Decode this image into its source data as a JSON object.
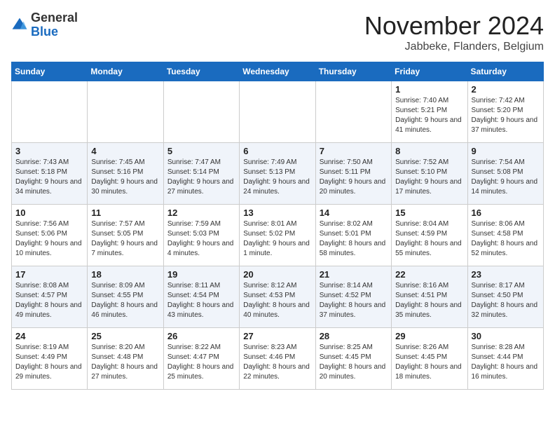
{
  "logo": {
    "general": "General",
    "blue": "Blue"
  },
  "title": "November 2024",
  "location": "Jabbeke, Flanders, Belgium",
  "days_of_week": [
    "Sunday",
    "Monday",
    "Tuesday",
    "Wednesday",
    "Thursday",
    "Friday",
    "Saturday"
  ],
  "weeks": [
    [
      {
        "day": "",
        "info": ""
      },
      {
        "day": "",
        "info": ""
      },
      {
        "day": "",
        "info": ""
      },
      {
        "day": "",
        "info": ""
      },
      {
        "day": "",
        "info": ""
      },
      {
        "day": "1",
        "info": "Sunrise: 7:40 AM\nSunset: 5:21 PM\nDaylight: 9 hours and 41 minutes."
      },
      {
        "day": "2",
        "info": "Sunrise: 7:42 AM\nSunset: 5:20 PM\nDaylight: 9 hours and 37 minutes."
      }
    ],
    [
      {
        "day": "3",
        "info": "Sunrise: 7:43 AM\nSunset: 5:18 PM\nDaylight: 9 hours and 34 minutes."
      },
      {
        "day": "4",
        "info": "Sunrise: 7:45 AM\nSunset: 5:16 PM\nDaylight: 9 hours and 30 minutes."
      },
      {
        "day": "5",
        "info": "Sunrise: 7:47 AM\nSunset: 5:14 PM\nDaylight: 9 hours and 27 minutes."
      },
      {
        "day": "6",
        "info": "Sunrise: 7:49 AM\nSunset: 5:13 PM\nDaylight: 9 hours and 24 minutes."
      },
      {
        "day": "7",
        "info": "Sunrise: 7:50 AM\nSunset: 5:11 PM\nDaylight: 9 hours and 20 minutes."
      },
      {
        "day": "8",
        "info": "Sunrise: 7:52 AM\nSunset: 5:10 PM\nDaylight: 9 hours and 17 minutes."
      },
      {
        "day": "9",
        "info": "Sunrise: 7:54 AM\nSunset: 5:08 PM\nDaylight: 9 hours and 14 minutes."
      }
    ],
    [
      {
        "day": "10",
        "info": "Sunrise: 7:56 AM\nSunset: 5:06 PM\nDaylight: 9 hours and 10 minutes."
      },
      {
        "day": "11",
        "info": "Sunrise: 7:57 AM\nSunset: 5:05 PM\nDaylight: 9 hours and 7 minutes."
      },
      {
        "day": "12",
        "info": "Sunrise: 7:59 AM\nSunset: 5:03 PM\nDaylight: 9 hours and 4 minutes."
      },
      {
        "day": "13",
        "info": "Sunrise: 8:01 AM\nSunset: 5:02 PM\nDaylight: 9 hours and 1 minute."
      },
      {
        "day": "14",
        "info": "Sunrise: 8:02 AM\nSunset: 5:01 PM\nDaylight: 8 hours and 58 minutes."
      },
      {
        "day": "15",
        "info": "Sunrise: 8:04 AM\nSunset: 4:59 PM\nDaylight: 8 hours and 55 minutes."
      },
      {
        "day": "16",
        "info": "Sunrise: 8:06 AM\nSunset: 4:58 PM\nDaylight: 8 hours and 52 minutes."
      }
    ],
    [
      {
        "day": "17",
        "info": "Sunrise: 8:08 AM\nSunset: 4:57 PM\nDaylight: 8 hours and 49 minutes."
      },
      {
        "day": "18",
        "info": "Sunrise: 8:09 AM\nSunset: 4:55 PM\nDaylight: 8 hours and 46 minutes."
      },
      {
        "day": "19",
        "info": "Sunrise: 8:11 AM\nSunset: 4:54 PM\nDaylight: 8 hours and 43 minutes."
      },
      {
        "day": "20",
        "info": "Sunrise: 8:12 AM\nSunset: 4:53 PM\nDaylight: 8 hours and 40 minutes."
      },
      {
        "day": "21",
        "info": "Sunrise: 8:14 AM\nSunset: 4:52 PM\nDaylight: 8 hours and 37 minutes."
      },
      {
        "day": "22",
        "info": "Sunrise: 8:16 AM\nSunset: 4:51 PM\nDaylight: 8 hours and 35 minutes."
      },
      {
        "day": "23",
        "info": "Sunrise: 8:17 AM\nSunset: 4:50 PM\nDaylight: 8 hours and 32 minutes."
      }
    ],
    [
      {
        "day": "24",
        "info": "Sunrise: 8:19 AM\nSunset: 4:49 PM\nDaylight: 8 hours and 29 minutes."
      },
      {
        "day": "25",
        "info": "Sunrise: 8:20 AM\nSunset: 4:48 PM\nDaylight: 8 hours and 27 minutes."
      },
      {
        "day": "26",
        "info": "Sunrise: 8:22 AM\nSunset: 4:47 PM\nDaylight: 8 hours and 25 minutes."
      },
      {
        "day": "27",
        "info": "Sunrise: 8:23 AM\nSunset: 4:46 PM\nDaylight: 8 hours and 22 minutes."
      },
      {
        "day": "28",
        "info": "Sunrise: 8:25 AM\nSunset: 4:45 PM\nDaylight: 8 hours and 20 minutes."
      },
      {
        "day": "29",
        "info": "Sunrise: 8:26 AM\nSunset: 4:45 PM\nDaylight: 8 hours and 18 minutes."
      },
      {
        "day": "30",
        "info": "Sunrise: 8:28 AM\nSunset: 4:44 PM\nDaylight: 8 hours and 16 minutes."
      }
    ]
  ]
}
